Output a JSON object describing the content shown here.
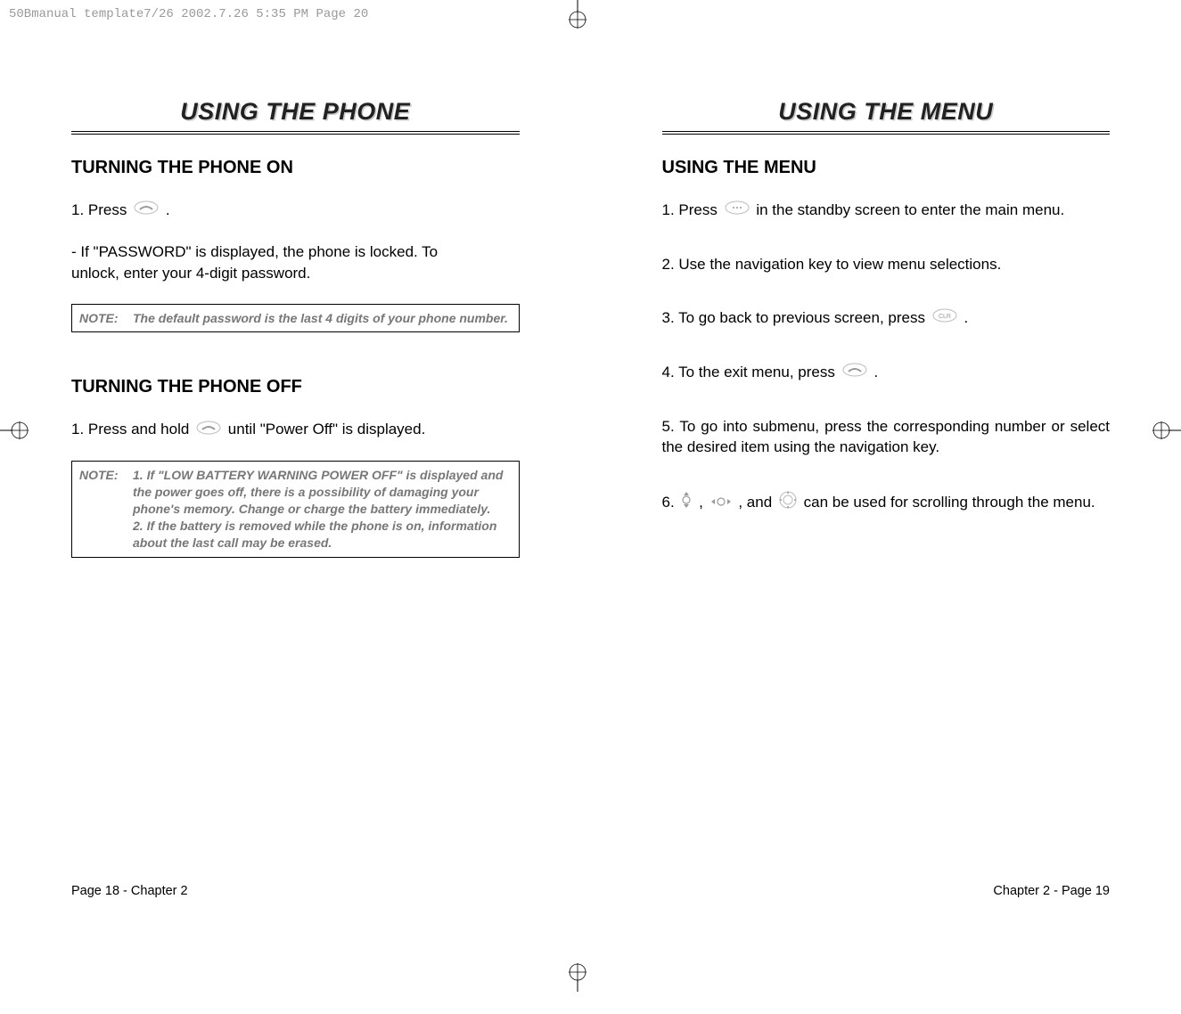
{
  "meta": {
    "header": "50Bmanual template7/26  2002.7.26  5:35 PM  Page 20"
  },
  "left": {
    "title": "USING THE PHONE",
    "section1": {
      "heading": "TURNING THE PHONE ON",
      "line1_a": "1. Press",
      "line1_b": ".",
      "line2": "- If \"PASSWORD\" is displayed, the phone is locked. To\n  unlock, enter your 4-digit password.",
      "note_label": "NOTE:",
      "note_text": "The default password is the last 4 digits of your phone number."
    },
    "section2": {
      "heading": "TURNING THE PHONE OFF",
      "line1_a": "1. Press and hold",
      "line1_b": "until \"Power Off\" is displayed.",
      "note_label": "NOTE:",
      "note_text": "1. If \"LOW BATTERY WARNING POWER OFF\" is displayed and the power goes off, there is a possibility of damaging your phone's memory. Change or charge the battery immediately.\n2. If the battery is removed while the phone is on, information about the last call may be erased."
    },
    "footer": "Page 18 - Chapter 2"
  },
  "right": {
    "title": "USING THE MENU",
    "heading": "USING THE MENU",
    "line1_a": "1. Press",
    "line1_b": "in the standby screen to enter the main menu.",
    "line2": "2. Use the navigation key to view menu selections.",
    "line3_a": "3. To go back to previous screen, press",
    "line3_b": ".",
    "line4_a": "4. To the exit menu, press",
    "line4_b": ".",
    "line5": "5. To go into submenu, press the corresponding number or select the desired item using the navigation key.",
    "line6_a": "6.",
    "line6_b": ",",
    "line6_c": ", and",
    "line6_d": "can be used for scrolling through the menu.",
    "footer": "Chapter 2 - Page 19"
  }
}
